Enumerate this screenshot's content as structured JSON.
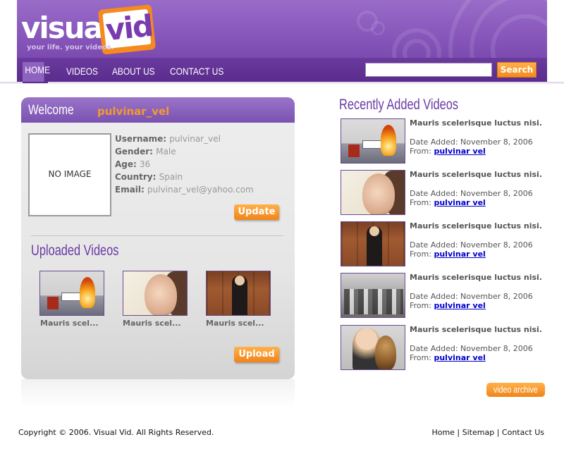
{
  "brand": {
    "name_part1": "visual",
    "name_part2": "vid",
    "tagline": "your life. your videos."
  },
  "nav": {
    "items": [
      "HOME",
      "VIDEOS",
      "ABOUT US",
      "CONTACT US"
    ],
    "active": "HOME"
  },
  "search": {
    "value": "",
    "button_label": "Search"
  },
  "welcome": {
    "title": "Welcome",
    "username": "pulvinar_vel",
    "no_image": "NO IMAGE",
    "fields": [
      {
        "label": "Username:",
        "value": "pulvinar_vel"
      },
      {
        "label": "Gender:",
        "value": "Male"
      },
      {
        "label": "Age:",
        "value": "36"
      },
      {
        "label": "Country:",
        "value": "Spain"
      },
      {
        "label": "Email:",
        "value": "pulvinar_vel@yahoo.com"
      }
    ],
    "update_label": "Update"
  },
  "uploaded": {
    "title": "Uploaded Videos",
    "items": [
      {
        "caption": "Mauris scel...",
        "image": "fire-room"
      },
      {
        "caption": "Mauris scel...",
        "image": "woman-portrait"
      },
      {
        "caption": "Mauris scel...",
        "image": "masked-woman"
      }
    ],
    "upload_label": "Upload"
  },
  "recent": {
    "title": "Recently Added Videos",
    "items": [
      {
        "title": "Mauris scelerisque luctus nisi.",
        "date": "Date Added: November 8, 2006",
        "from_label": "From:",
        "from_user": "pulvinar vel",
        "image": "fire-room"
      },
      {
        "title": "Mauris scelerisque luctus nisi.",
        "date": "Date Added: November 8, 2006",
        "from_label": "From:",
        "from_user": "pulvinar vel",
        "image": "woman-portrait"
      },
      {
        "title": "Mauris scelerisque luctus nisi.",
        "date": "Date Added: November 8, 2006",
        "from_label": "From:",
        "from_user": "pulvinar vel",
        "image": "masked-woman"
      },
      {
        "title": "Mauris scelerisque luctus nisi.",
        "date": "Date Added: November 8, 2006",
        "from_label": "From:",
        "from_user": "pulvinar vel",
        "image": "vintage-crowd"
      },
      {
        "title": "Mauris scelerisque luctus nisi.",
        "date": "Date Added: November 8, 2006",
        "from_label": "From:",
        "from_user": "pulvinar vel",
        "image": "woman-with-owl"
      }
    ],
    "archive_label": "video archive"
  },
  "footer": {
    "copyright": "Copyright © 2006. Visual Vid. All Rights Reserved.",
    "links": [
      "Home",
      "Sitemap",
      "Contact Us"
    ],
    "separator": "|"
  },
  "colors": {
    "purple": "#7a4aaf",
    "orange": "#f58a1f",
    "link": "#0000cc"
  }
}
